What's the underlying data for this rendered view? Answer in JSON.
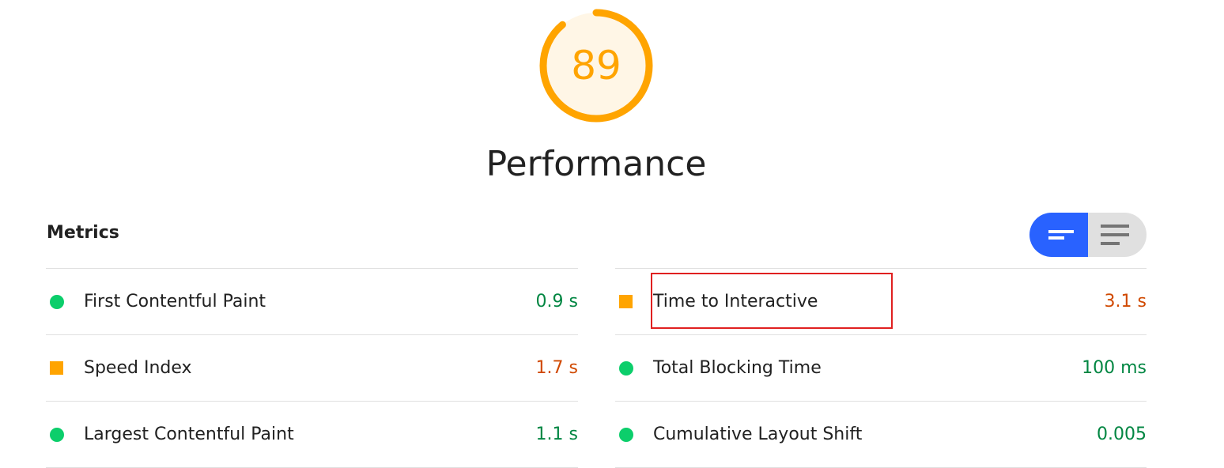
{
  "score": {
    "value": "89",
    "fraction": 0.89,
    "color": "#ffa400",
    "bg": "#fff6e6"
  },
  "category_title": "Performance",
  "metrics_heading": "Metrics",
  "metrics": [
    {
      "label": "First Contentful Paint",
      "value": "0.9 s",
      "status": "pass"
    },
    {
      "label": "Time to Interactive",
      "value": "3.1 s",
      "status": "average"
    },
    {
      "label": "Speed Index",
      "value": "1.7 s",
      "status": "average"
    },
    {
      "label": "Total Blocking Time",
      "value": "100 ms",
      "status": "pass"
    },
    {
      "label": "Largest Contentful Paint",
      "value": "1.1 s",
      "status": "pass"
    },
    {
      "label": "Cumulative Layout Shift",
      "value": "0.005",
      "status": "pass"
    }
  ]
}
